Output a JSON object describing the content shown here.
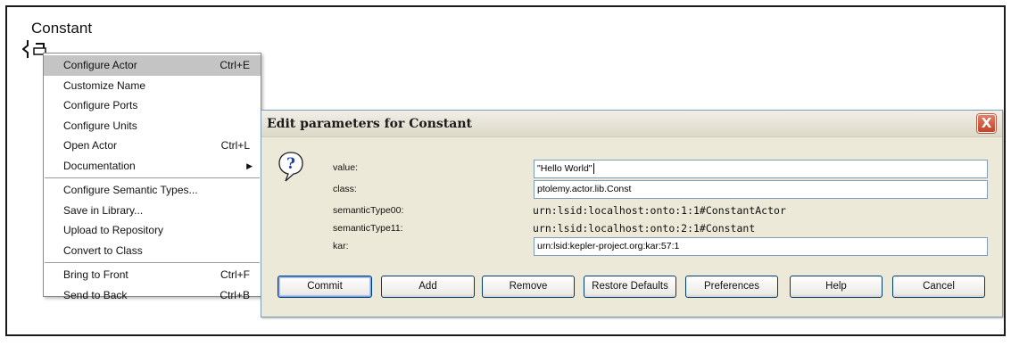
{
  "canvas": {
    "actor_title": "Constant"
  },
  "context_menu": {
    "items": [
      {
        "label": "Configure Actor",
        "shortcut": "Ctrl+E"
      },
      {
        "label": "Customize Name",
        "shortcut": ""
      },
      {
        "label": "Configure Ports",
        "shortcut": ""
      },
      {
        "label": "Configure Units",
        "shortcut": ""
      },
      {
        "label": "Open Actor",
        "shortcut": "Ctrl+L"
      },
      {
        "label": "Documentation",
        "shortcut": ""
      },
      {
        "label": "Configure Semantic Types...",
        "shortcut": ""
      },
      {
        "label": "Save in Library...",
        "shortcut": ""
      },
      {
        "label": "Upload to Repository",
        "shortcut": ""
      },
      {
        "label": "Convert to Class",
        "shortcut": ""
      },
      {
        "label": "Bring to Front",
        "shortcut": "Ctrl+F"
      },
      {
        "label": "Send to Back",
        "shortcut": "Ctrl+B"
      }
    ]
  },
  "dialog": {
    "title": "Edit parameters for Constant",
    "close_glyph": "X",
    "params": {
      "value_label": "value:",
      "value": "\"Hello World\"",
      "class_label": "class:",
      "class_value": "ptolemy.actor.lib.Const",
      "st00_label": "semanticType00:",
      "st00_value": "urn:lsid:localhost:onto:1:1#ConstantActor",
      "st11_label": "semanticType11:",
      "st11_value": "urn:lsid:localhost:onto:2:1#Constant",
      "kar_label": "kar:",
      "kar_value": "urn:lsid:kepler-project.org:kar:57:1"
    },
    "buttons": {
      "commit": "Commit",
      "add": "Add",
      "remove": "Remove",
      "restore": "Restore Defaults",
      "preferences": "Preferences",
      "help": "Help",
      "cancel": "Cancel"
    }
  },
  "icons": {
    "actor": "constant-actor-icon",
    "question": "question-icon",
    "close": "close-icon",
    "submenu": "chevron-right-icon"
  },
  "colors": {
    "menu_selected": "#c4c4c4",
    "dialog_bg": "#ece9d8",
    "close_button": "#c0432a",
    "button_border": "#003c74"
  }
}
